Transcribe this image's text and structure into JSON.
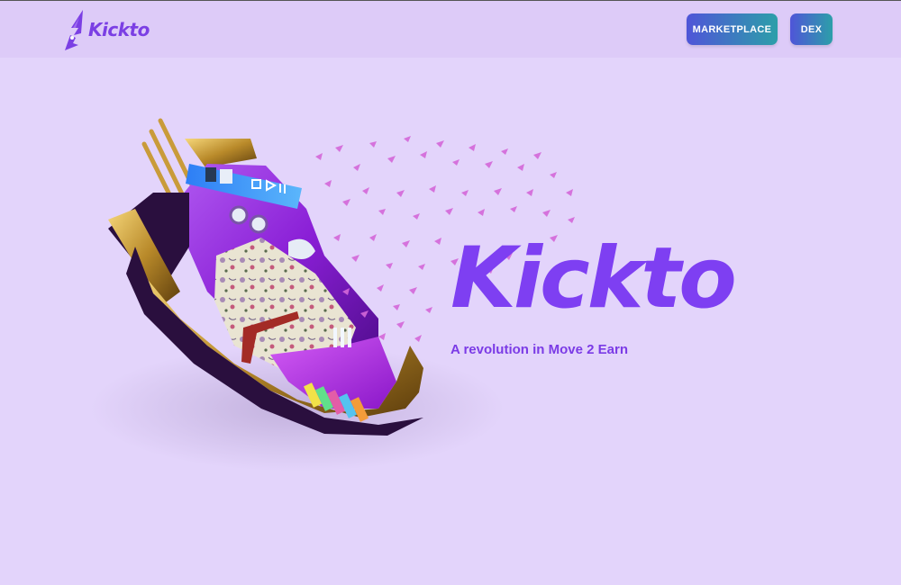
{
  "header": {
    "logo_text": "Kickto",
    "marketplace_label": "MARKETPLACE",
    "dex_label": "DEX"
  },
  "hero": {
    "title": "Kickto",
    "subtitle": "A revolution in Move 2 Earn"
  },
  "colors": {
    "page_background": "#e3d4fb",
    "header_background": "#ddcbf8",
    "brand_purple": "#7e3ff2",
    "button_gradient_start": "#4f55d8",
    "button_gradient_end": "#2c9fa9"
  }
}
